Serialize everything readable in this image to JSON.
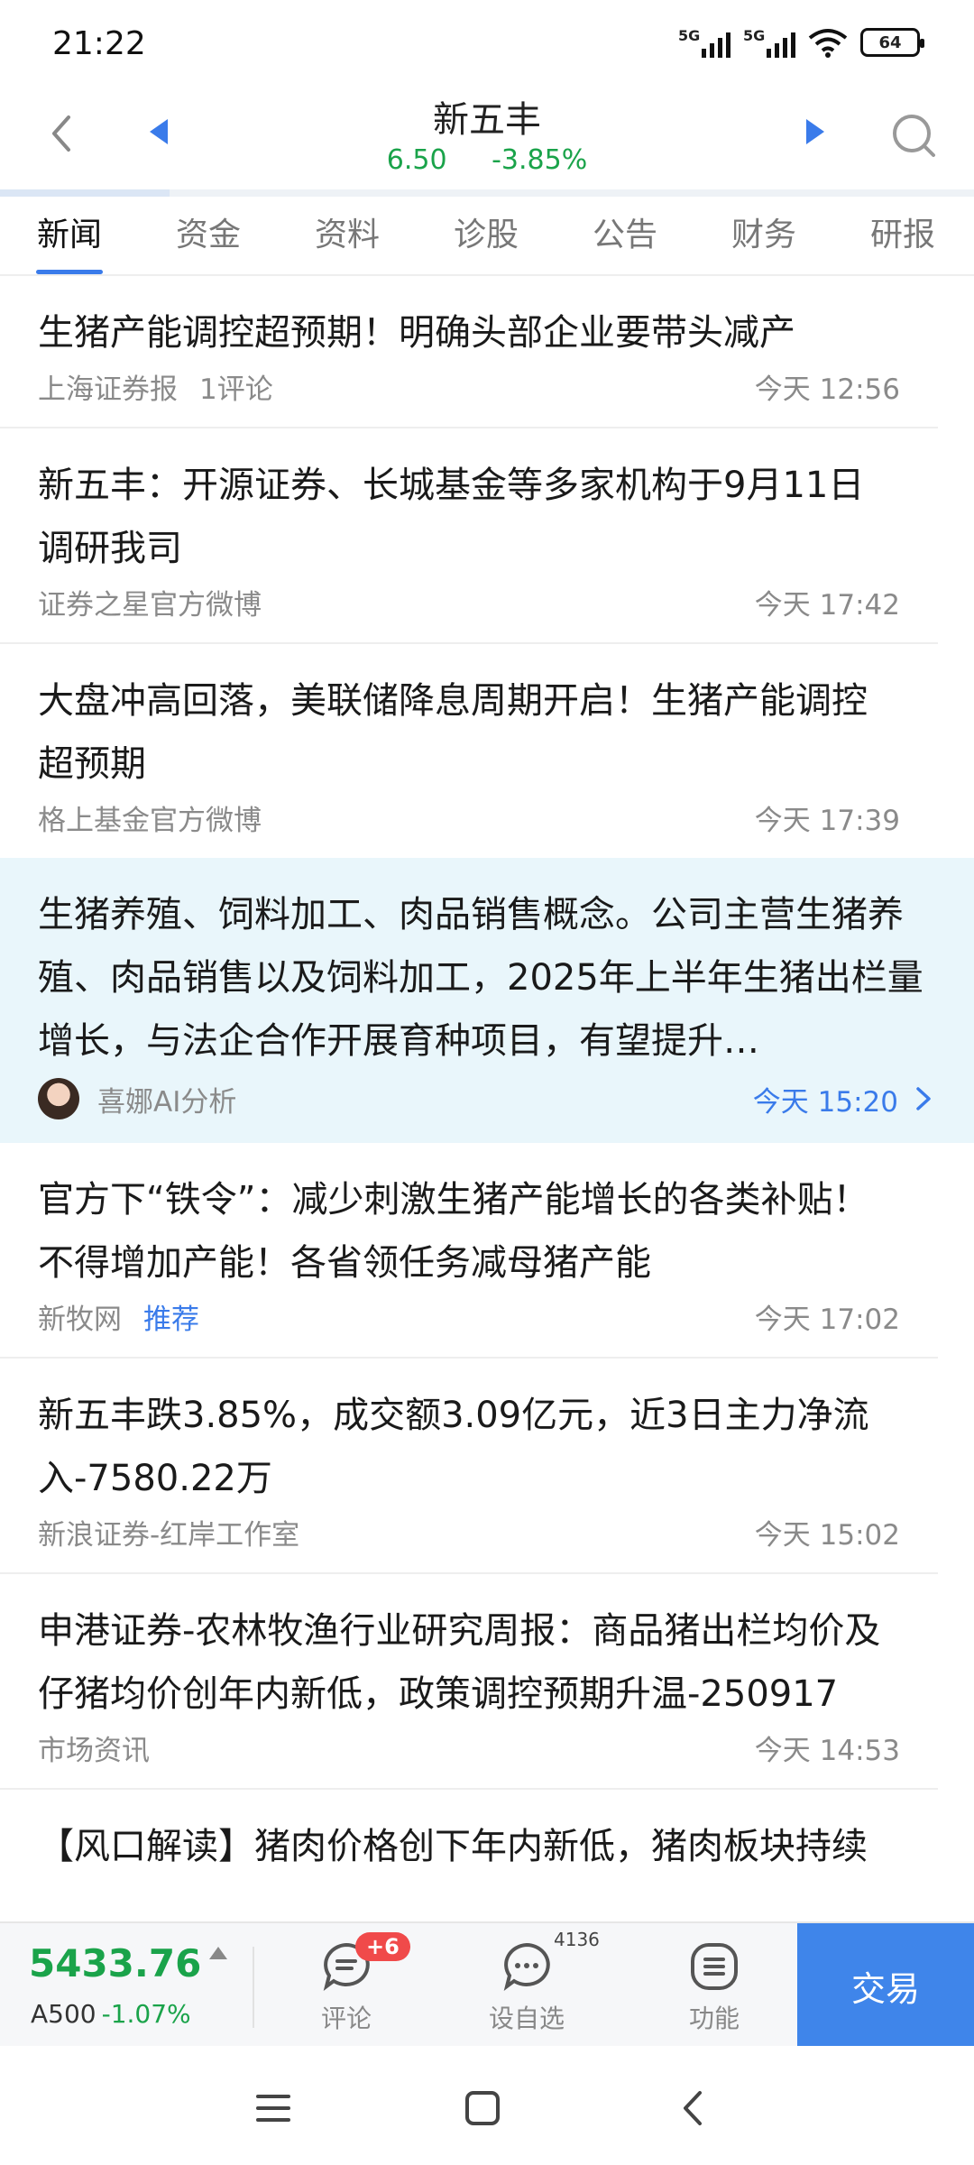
{
  "status": {
    "time": "21:22",
    "battery": "64",
    "net1": "5G",
    "net2": "5G"
  },
  "header": {
    "title": "新五丰",
    "price": "6.50",
    "change_pct": "-3.85%"
  },
  "tabs": [
    {
      "label": "新闻"
    },
    {
      "label": "资金"
    },
    {
      "label": "资料"
    },
    {
      "label": "诊股"
    },
    {
      "label": "公告"
    },
    {
      "label": "财务"
    },
    {
      "label": "研报"
    }
  ],
  "news": [
    {
      "headline": "生猪产能调控超预期！明确头部企业要带头减产",
      "source": "上海证券报",
      "extra": "1评论",
      "time": "今天 12:56"
    },
    {
      "headline": "新五丰：开源证券、长城基金等多家机构于9月11日调研我司",
      "source": "证券之星官方微博",
      "extra": "",
      "time": "今天 17:42"
    },
    {
      "headline": "大盘冲高回落，美联储降息周期开启！生猪产能调控超预期",
      "source": "格上基金官方微博",
      "extra": "",
      "time": "今天 17:39"
    }
  ],
  "ai_item": {
    "headline": "生猪养殖、饲料加工、肉品销售概念。公司主营生猪养殖、肉品销售以及饲料加工，2025年上半年生猪出栏量增长，与法企合作开展育种项目，有望提升…",
    "source": "喜娜AI分析",
    "time": "今天 15:20"
  },
  "news2": [
    {
      "headline": "官方下“铁令”：减少刺激生猪产能增长的各类补贴！不得增加产能！各省领任务减母猪产能",
      "source": "新牧网",
      "tag": "推荐",
      "time": "今天 17:02"
    },
    {
      "headline": "新五丰跌3.85%，成交额3.09亿元，近3日主力净流入-7580.22万",
      "source": "新浪证券-红岸工作室",
      "tag": "",
      "time": "今天 15:02"
    },
    {
      "headline": "申港证券-农林牧渔行业研究周报：商品猪出栏均价及仔猪均价创年内新低，政策调控预期升温-250917",
      "source": "市场资讯",
      "tag": "",
      "time": "今天 14:53"
    }
  ],
  "last_item": {
    "headline": "【风口解读】猪肉价格创下年内新低，猪肉板块持续"
  },
  "bottom": {
    "index_value": "5433.76",
    "index_name": "A500",
    "index_change": "-1.07%",
    "comment_label": "评论",
    "comment_badge": "+6",
    "watch_label": "设自选",
    "watch_count": "4136",
    "func_label": "功能",
    "trade_label": "交易"
  },
  "colors": {
    "accent": "#3a7bea",
    "down": "#1aa34a",
    "badge": "#f04a4a",
    "trade": "#3f85ea",
    "ai_bg": "#e9f6fb"
  }
}
